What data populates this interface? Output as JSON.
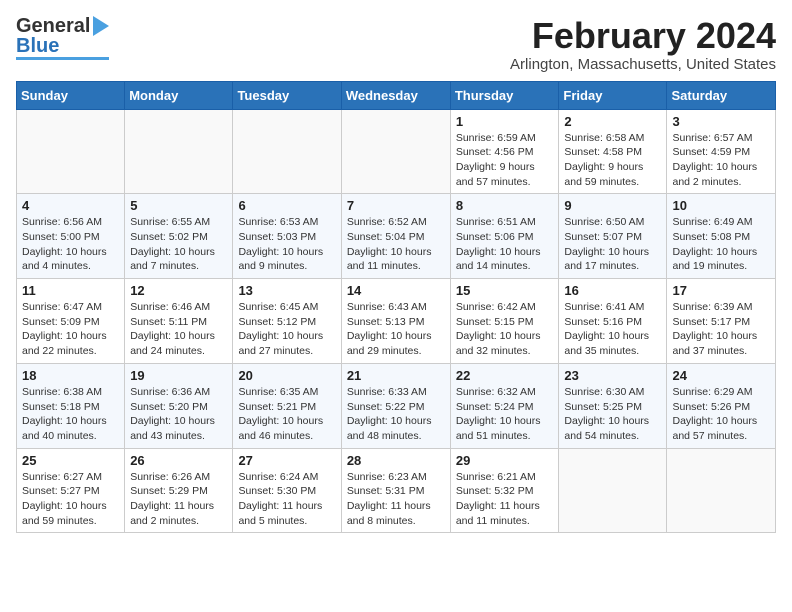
{
  "header": {
    "logo_general": "General",
    "logo_blue": "Blue",
    "title": "February 2024",
    "location": "Arlington, Massachusetts, United States"
  },
  "columns": [
    "Sunday",
    "Monday",
    "Tuesday",
    "Wednesday",
    "Thursday",
    "Friday",
    "Saturday"
  ],
  "weeks": [
    [
      {
        "day": "",
        "info": ""
      },
      {
        "day": "",
        "info": ""
      },
      {
        "day": "",
        "info": ""
      },
      {
        "day": "",
        "info": ""
      },
      {
        "day": "1",
        "info": "Sunrise: 6:59 AM\nSunset: 4:56 PM\nDaylight: 9 hours\nand 57 minutes."
      },
      {
        "day": "2",
        "info": "Sunrise: 6:58 AM\nSunset: 4:58 PM\nDaylight: 9 hours\nand 59 minutes."
      },
      {
        "day": "3",
        "info": "Sunrise: 6:57 AM\nSunset: 4:59 PM\nDaylight: 10 hours\nand 2 minutes."
      }
    ],
    [
      {
        "day": "4",
        "info": "Sunrise: 6:56 AM\nSunset: 5:00 PM\nDaylight: 10 hours\nand 4 minutes."
      },
      {
        "day": "5",
        "info": "Sunrise: 6:55 AM\nSunset: 5:02 PM\nDaylight: 10 hours\nand 7 minutes."
      },
      {
        "day": "6",
        "info": "Sunrise: 6:53 AM\nSunset: 5:03 PM\nDaylight: 10 hours\nand 9 minutes."
      },
      {
        "day": "7",
        "info": "Sunrise: 6:52 AM\nSunset: 5:04 PM\nDaylight: 10 hours\nand 11 minutes."
      },
      {
        "day": "8",
        "info": "Sunrise: 6:51 AM\nSunset: 5:06 PM\nDaylight: 10 hours\nand 14 minutes."
      },
      {
        "day": "9",
        "info": "Sunrise: 6:50 AM\nSunset: 5:07 PM\nDaylight: 10 hours\nand 17 minutes."
      },
      {
        "day": "10",
        "info": "Sunrise: 6:49 AM\nSunset: 5:08 PM\nDaylight: 10 hours\nand 19 minutes."
      }
    ],
    [
      {
        "day": "11",
        "info": "Sunrise: 6:47 AM\nSunset: 5:09 PM\nDaylight: 10 hours\nand 22 minutes."
      },
      {
        "day": "12",
        "info": "Sunrise: 6:46 AM\nSunset: 5:11 PM\nDaylight: 10 hours\nand 24 minutes."
      },
      {
        "day": "13",
        "info": "Sunrise: 6:45 AM\nSunset: 5:12 PM\nDaylight: 10 hours\nand 27 minutes."
      },
      {
        "day": "14",
        "info": "Sunrise: 6:43 AM\nSunset: 5:13 PM\nDaylight: 10 hours\nand 29 minutes."
      },
      {
        "day": "15",
        "info": "Sunrise: 6:42 AM\nSunset: 5:15 PM\nDaylight: 10 hours\nand 32 minutes."
      },
      {
        "day": "16",
        "info": "Sunrise: 6:41 AM\nSunset: 5:16 PM\nDaylight: 10 hours\nand 35 minutes."
      },
      {
        "day": "17",
        "info": "Sunrise: 6:39 AM\nSunset: 5:17 PM\nDaylight: 10 hours\nand 37 minutes."
      }
    ],
    [
      {
        "day": "18",
        "info": "Sunrise: 6:38 AM\nSunset: 5:18 PM\nDaylight: 10 hours\nand 40 minutes."
      },
      {
        "day": "19",
        "info": "Sunrise: 6:36 AM\nSunset: 5:20 PM\nDaylight: 10 hours\nand 43 minutes."
      },
      {
        "day": "20",
        "info": "Sunrise: 6:35 AM\nSunset: 5:21 PM\nDaylight: 10 hours\nand 46 minutes."
      },
      {
        "day": "21",
        "info": "Sunrise: 6:33 AM\nSunset: 5:22 PM\nDaylight: 10 hours\nand 48 minutes."
      },
      {
        "day": "22",
        "info": "Sunrise: 6:32 AM\nSunset: 5:24 PM\nDaylight: 10 hours\nand 51 minutes."
      },
      {
        "day": "23",
        "info": "Sunrise: 6:30 AM\nSunset: 5:25 PM\nDaylight: 10 hours\nand 54 minutes."
      },
      {
        "day": "24",
        "info": "Sunrise: 6:29 AM\nSunset: 5:26 PM\nDaylight: 10 hours\nand 57 minutes."
      }
    ],
    [
      {
        "day": "25",
        "info": "Sunrise: 6:27 AM\nSunset: 5:27 PM\nDaylight: 10 hours\nand 59 minutes."
      },
      {
        "day": "26",
        "info": "Sunrise: 6:26 AM\nSunset: 5:29 PM\nDaylight: 11 hours\nand 2 minutes."
      },
      {
        "day": "27",
        "info": "Sunrise: 6:24 AM\nSunset: 5:30 PM\nDaylight: 11 hours\nand 5 minutes."
      },
      {
        "day": "28",
        "info": "Sunrise: 6:23 AM\nSunset: 5:31 PM\nDaylight: 11 hours\nand 8 minutes."
      },
      {
        "day": "29",
        "info": "Sunrise: 6:21 AM\nSunset: 5:32 PM\nDaylight: 11 hours\nand 11 minutes."
      },
      {
        "day": "",
        "info": ""
      },
      {
        "day": "",
        "info": ""
      }
    ]
  ]
}
